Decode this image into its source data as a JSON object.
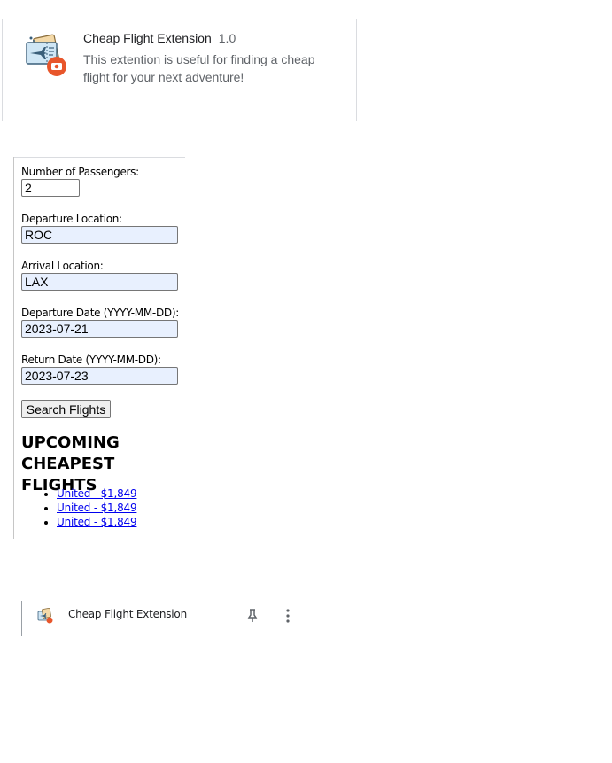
{
  "extension_card": {
    "name": "Cheap Flight Extension",
    "version": "1.0",
    "description": "This extention is useful for finding a cheap flight for your next adventure!",
    "icon": "flight-ticket-icon",
    "badge_icon": "camera-badge-icon"
  },
  "popup": {
    "passengers": {
      "label": "Number of Passengers:",
      "value": "2"
    },
    "departure_location": {
      "label": "Departure Location:",
      "value": "ROC"
    },
    "arrival_location": {
      "label": "Arrival Location:",
      "value": "LAX"
    },
    "departure_date": {
      "label": "Departure Date (YYYY-MM-DD):",
      "value": "2023-07-21"
    },
    "return_date": {
      "label": "Return Date (YYYY-MM-DD):",
      "value": "2023-07-23"
    },
    "search_button": "Search Flights",
    "heading": "UPCOMING CHEAPEST FLIGHTS",
    "flights": [
      "United - $1,849",
      "United - $1,849",
      "United - $1,849"
    ]
  },
  "toolbar_menu": {
    "label": "Cheap Flight Extension",
    "pin_icon": "pin-icon",
    "more_icon": "more-vertical-icon"
  },
  "colors": {
    "autofill_bg": "#e8f0fe",
    "link": "#0000ee",
    "badge": "#e8562b",
    "secondary_text": "#5f6368"
  }
}
